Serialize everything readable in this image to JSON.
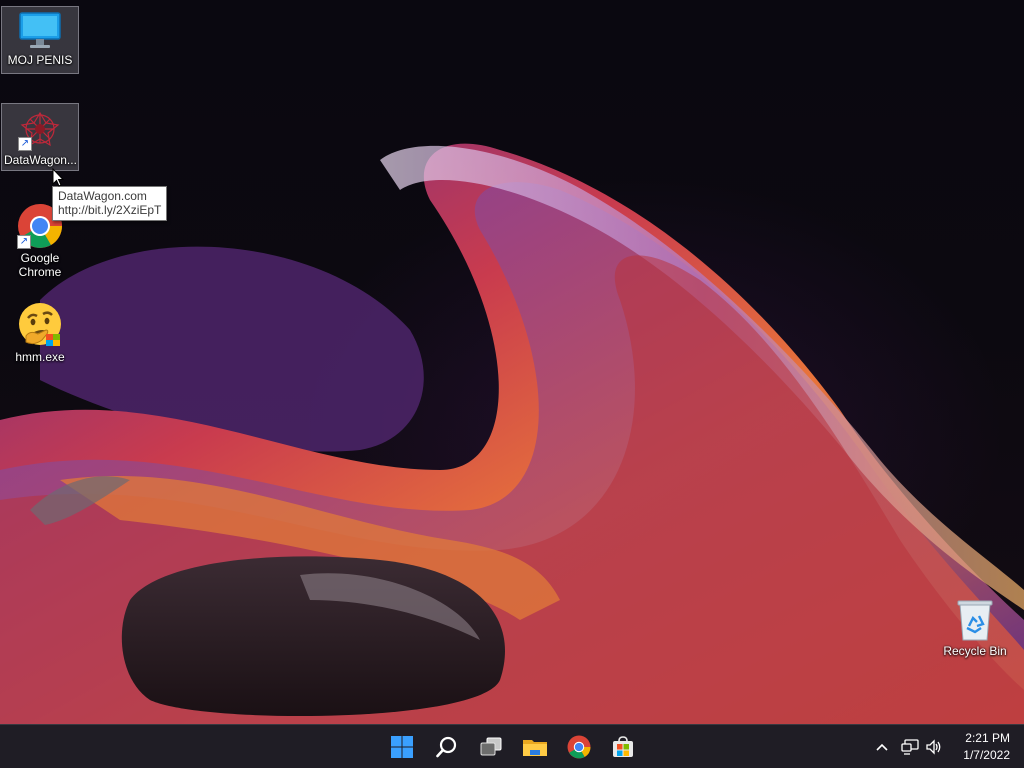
{
  "desktop": {
    "icons": [
      {
        "label": "MOJ PENIS",
        "icon": "monitor-icon"
      },
      {
        "label": "DataWagon...",
        "icon": "datawagon-icon",
        "shortcut": true
      },
      {
        "label": "Google\nChrome",
        "label_line1": "Google",
        "label_line2": "Chrome",
        "icon": "chrome-icon",
        "shortcut": true
      },
      {
        "label": "hmm.exe",
        "icon": "thinking-emoji-icon"
      },
      {
        "label": "Recycle Bin",
        "icon": "recycle-bin-icon"
      }
    ],
    "tooltip": {
      "line1": "DataWagon.com",
      "line2": "http://bit.ly/2XziEpT"
    }
  },
  "taskbar": {
    "items": [
      {
        "name": "start",
        "icon": "windows-start-icon"
      },
      {
        "name": "search",
        "icon": "search-icon"
      },
      {
        "name": "task-view",
        "icon": "task-view-icon"
      },
      {
        "name": "file-explorer",
        "icon": "folder-icon"
      },
      {
        "name": "chrome",
        "icon": "chrome-icon"
      },
      {
        "name": "store",
        "icon": "store-icon"
      }
    ],
    "tray": {
      "chevron_icon": "chevron-up-icon",
      "network_icon": "network-icon",
      "volume_icon": "volume-icon"
    },
    "clock": {
      "time": "2:21 PM",
      "date": "1/7/2022"
    }
  },
  "colors": {
    "taskbar_bg": "#201e26",
    "accent": "#1a73e8"
  }
}
